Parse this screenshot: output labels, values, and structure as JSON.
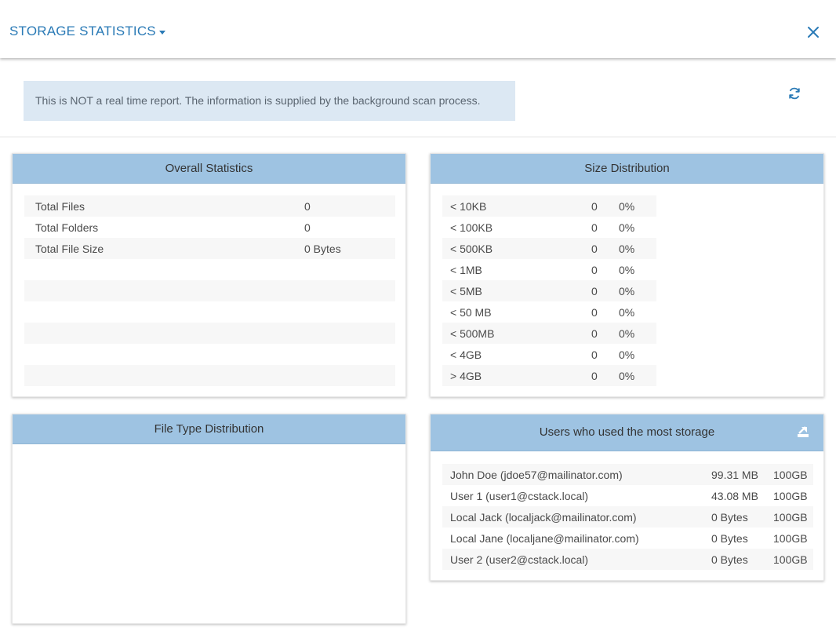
{
  "header": {
    "title": "STORAGE STATISTICS"
  },
  "notice": "This is NOT a real time report. The information is supplied by the background scan process.",
  "overall": {
    "title": "Overall Statistics",
    "rows": [
      {
        "label": "Total Files",
        "value": "0"
      },
      {
        "label": "Total Folders",
        "value": "0"
      },
      {
        "label": "Total File Size",
        "value": "0 Bytes"
      },
      {
        "label": "",
        "value": ""
      },
      {
        "label": "",
        "value": ""
      },
      {
        "label": "",
        "value": ""
      },
      {
        "label": "",
        "value": ""
      },
      {
        "label": "",
        "value": ""
      },
      {
        "label": "",
        "value": ""
      }
    ]
  },
  "size_distribution": {
    "title": "Size Distribution",
    "rows": [
      {
        "label": "< 10KB",
        "count": "0",
        "percent": "0%"
      },
      {
        "label": "< 100KB",
        "count": "0",
        "percent": "0%"
      },
      {
        "label": "< 500KB",
        "count": "0",
        "percent": "0%"
      },
      {
        "label": "< 1MB",
        "count": "0",
        "percent": "0%"
      },
      {
        "label": "< 5MB",
        "count": "0",
        "percent": "0%"
      },
      {
        "label": "< 50 MB",
        "count": "0",
        "percent": "0%"
      },
      {
        "label": "< 500MB",
        "count": "0",
        "percent": "0%"
      },
      {
        "label": "< 4GB",
        "count": "0",
        "percent": "0%"
      },
      {
        "label": "> 4GB",
        "count": "0",
        "percent": "0%"
      }
    ]
  },
  "file_type": {
    "title": "File Type Distribution"
  },
  "users": {
    "title": "Users who used the most storage",
    "rows": [
      {
        "user": "John Doe (jdoe57@mailinator.com)",
        "used": "99.31 MB",
        "quota": "100GB"
      },
      {
        "user": "User 1 (user1@cstack.local)",
        "used": "43.08 MB",
        "quota": "100GB"
      },
      {
        "user": "Local Jack (localjack@mailinator.com)",
        "used": "0 Bytes",
        "quota": "100GB"
      },
      {
        "user": "Local Jane (localjane@mailinator.com)",
        "used": "0 Bytes",
        "quota": "100GB"
      },
      {
        "user": "User 2 (user2@cstack.local)",
        "used": "0 Bytes",
        "quota": "100GB"
      }
    ]
  },
  "icons": {
    "close": "close-icon",
    "refresh": "refresh-icon",
    "export": "export-icon",
    "caret": "caret-down-icon"
  },
  "colors": {
    "accent": "#2a7ab6",
    "panel_header": "#9ec3e2",
    "notice_bg": "#dce8f3",
    "row_alt": "#f7f7f7"
  }
}
